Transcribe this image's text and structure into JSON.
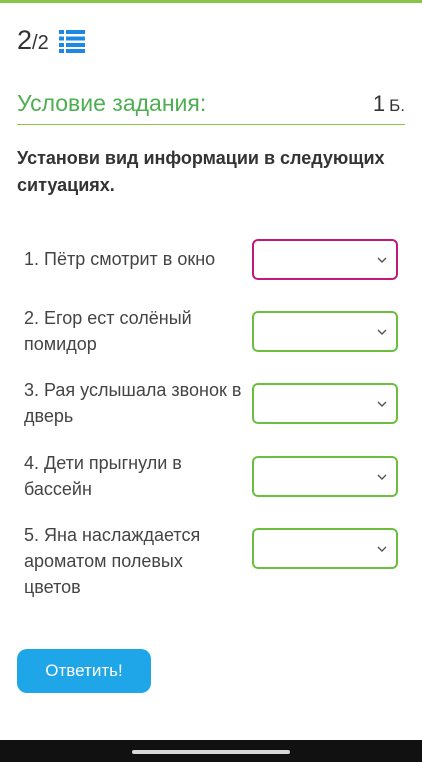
{
  "header": {
    "current": "2",
    "total": "/2",
    "list_icon": "list-icon"
  },
  "section": {
    "title": "Условие задания:",
    "points": "1",
    "points_unit": "Б."
  },
  "question": "Установи вид информации в следующих ситуациях.",
  "items": [
    {
      "text": "1. Пётр смотрит в окно",
      "selected": ""
    },
    {
      "text": "2. Егор ест солёный помидор",
      "selected": ""
    },
    {
      "text": "3. Рая услышала звонок в дверь",
      "selected": ""
    },
    {
      "text": "4. Дети прыгнули в бассейн",
      "selected": ""
    },
    {
      "text": "5. Яна наслаждается ароматом полевых цветов",
      "selected": ""
    }
  ],
  "submit_label": "Ответить!",
  "colors": {
    "accent_green": "#8bc34a",
    "title_green": "#4caf50",
    "select_border": "#6bbf3e",
    "focused_border": "#c2187a",
    "button_blue": "#1fa6e8"
  }
}
